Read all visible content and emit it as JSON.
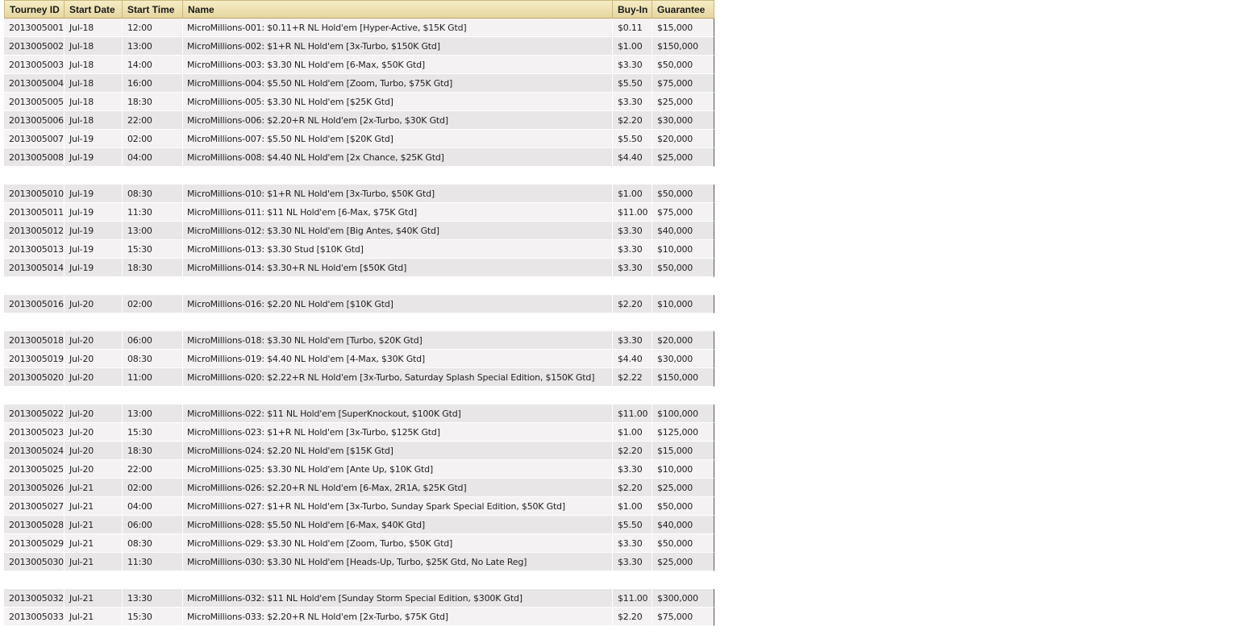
{
  "columns": [
    "Tourney ID",
    "Start Date",
    "Start Time",
    "Name",
    "Buy-In",
    "Guarantee"
  ],
  "rows": [
    {
      "id": "2013005001",
      "date": "Jul-18",
      "time": "12:00",
      "name": "MicroMillions-001: $0.11+R NL Hold'em [Hyper-Active, $15K Gtd]",
      "buyin": "$0.11",
      "guarantee": "$15,000"
    },
    {
      "id": "2013005002",
      "date": "Jul-18",
      "time": "13:00",
      "name": "MicroMillions-002: $1+R NL Hold'em [3x-Turbo, $150K Gtd]",
      "buyin": "$1.00",
      "guarantee": "$150,000"
    },
    {
      "id": "2013005003",
      "date": "Jul-18",
      "time": "14:00",
      "name": "MicroMillions-003: $3.30 NL Hold'em [6-Max, $50K Gtd]",
      "buyin": "$3.30",
      "guarantee": "$50,000"
    },
    {
      "id": "2013005004",
      "date": "Jul-18",
      "time": "16:00",
      "name": "MicroMillions-004: $5.50 NL Hold'em [Zoom, Turbo, $75K Gtd]",
      "buyin": "$5.50",
      "guarantee": "$75,000"
    },
    {
      "id": "2013005005",
      "date": "Jul-18",
      "time": "18:30",
      "name": "MicroMillions-005: $3.30 NL Hold'em [$25K Gtd]",
      "buyin": "$3.30",
      "guarantee": "$25,000"
    },
    {
      "id": "2013005006",
      "date": "Jul-18",
      "time": "22:00",
      "name": "MicroMillions-006: $2.20+R NL Hold'em [2x-Turbo, $30K Gtd]",
      "buyin": "$2.20",
      "guarantee": "$30,000"
    },
    {
      "id": "2013005007",
      "date": "Jul-19",
      "time": "02:00",
      "name": "MicroMillions-007: $5.50 NL Hold'em [$20K Gtd]",
      "buyin": "$5.50",
      "guarantee": "$20,000"
    },
    {
      "id": "2013005008",
      "date": "Jul-19",
      "time": "04:00",
      "name": "MicroMillions-008: $4.40 NL Hold'em [2x Chance, $25K Gtd]",
      "buyin": "$4.40",
      "guarantee": "$25,000"
    },
    null,
    {
      "id": "2013005010",
      "date": "Jul-19",
      "time": "08:30",
      "name": "MicroMillions-010: $1+R NL Hold'em [3x-Turbo, $50K Gtd]",
      "buyin": "$1.00",
      "guarantee": "$50,000"
    },
    {
      "id": "2013005011",
      "date": "Jul-19",
      "time": "11:30",
      "name": "MicroMillions-011: $11 NL Hold'em [6-Max, $75K Gtd]",
      "buyin": "$11.00",
      "guarantee": "$75,000"
    },
    {
      "id": "2013005012",
      "date": "Jul-19",
      "time": "13:00",
      "name": "MicroMillions-012: $3.30 NL Hold'em [Big Antes, $40K Gtd]",
      "buyin": "$3.30",
      "guarantee": "$40,000"
    },
    {
      "id": "2013005013",
      "date": "Jul-19",
      "time": "15:30",
      "name": "MicroMillions-013: $3.30 Stud [$10K Gtd]",
      "buyin": "$3.30",
      "guarantee": "$10,000"
    },
    {
      "id": "2013005014",
      "date": "Jul-19",
      "time": "18:30",
      "name": "MicroMillions-014: $3.30+R NL Hold'em [$50K Gtd]",
      "buyin": "$3.30",
      "guarantee": "$50,000"
    },
    null,
    {
      "id": "2013005016",
      "date": "Jul-20",
      "time": "02:00",
      "name": "MicroMillions-016: $2.20 NL Hold'em [$10K Gtd]",
      "buyin": "$2.20",
      "guarantee": "$10,000"
    },
    null,
    {
      "id": "2013005018",
      "date": "Jul-20",
      "time": "06:00",
      "name": "MicroMillions-018: $3.30 NL Hold'em [Turbo, $20K Gtd]",
      "buyin": "$3.30",
      "guarantee": "$20,000"
    },
    {
      "id": "2013005019",
      "date": "Jul-20",
      "time": "08:30",
      "name": "MicroMillions-019: $4.40 NL Hold'em [4-Max, $30K Gtd]",
      "buyin": "$4.40",
      "guarantee": "$30,000"
    },
    {
      "id": "2013005020",
      "date": "Jul-20",
      "time": "11:00",
      "name": "MicroMillions-020: $2.22+R NL Hold'em [3x-Turbo, Saturday Splash Special Edition, $150K Gtd]",
      "buyin": "$2.22",
      "guarantee": "$150,000"
    },
    null,
    {
      "id": "2013005022",
      "date": "Jul-20",
      "time": "13:00",
      "name": "MicroMillions-022: $11 NL Hold'em [SuperKnockout, $100K Gtd]",
      "buyin": "$11.00",
      "guarantee": "$100,000"
    },
    {
      "id": "2013005023",
      "date": "Jul-20",
      "time": "15:30",
      "name": "MicroMillions-023: $1+R NL Hold'em [3x-Turbo, $125K Gtd]",
      "buyin": "$1.00",
      "guarantee": "$125,000"
    },
    {
      "id": "2013005024",
      "date": "Jul-20",
      "time": "18:30",
      "name": "MicroMillions-024: $2.20 NL Hold'em [$15K Gtd]",
      "buyin": "$2.20",
      "guarantee": "$15,000"
    },
    {
      "id": "2013005025",
      "date": "Jul-20",
      "time": "22:00",
      "name": "MicroMillions-025: $3.30 NL Hold'em [Ante Up, $10K Gtd]",
      "buyin": "$3.30",
      "guarantee": "$10,000"
    },
    {
      "id": "2013005026",
      "date": "Jul-21",
      "time": "02:00",
      "name": "MicroMillions-026: $2.20+R NL Hold'em [6-Max, 2R1A, $25K Gtd]",
      "buyin": "$2.20",
      "guarantee": "$25,000"
    },
    {
      "id": "2013005027",
      "date": "Jul-21",
      "time": "04:00",
      "name": "MicroMillions-027: $1+R NL Hold'em [3x-Turbo, Sunday Spark Special Edition, $50K Gtd]",
      "buyin": "$1.00",
      "guarantee": "$50,000"
    },
    {
      "id": "2013005028",
      "date": "Jul-21",
      "time": "06:00",
      "name": "MicroMillions-028: $5.50 NL Hold'em [6-Max, $40K Gtd]",
      "buyin": "$5.50",
      "guarantee": "$40,000"
    },
    {
      "id": "2013005029",
      "date": "Jul-21",
      "time": "08:30",
      "name": "MicroMillions-029: $3.30 NL Hold'em [Zoom, Turbo, $50K Gtd]",
      "buyin": "$3.30",
      "guarantee": "$50,000"
    },
    {
      "id": "2013005030",
      "date": "Jul-21",
      "time": "11:30",
      "name": "MicroMillions-030: $3.30 NL Hold'em [Heads-Up, Turbo, $25K Gtd, No Late Reg]",
      "buyin": "$3.30",
      "guarantee": "$25,000"
    },
    null,
    {
      "id": "2013005032",
      "date": "Jul-21",
      "time": "13:30",
      "name": "MicroMillions-032: $11 NL Hold'em [Sunday Storm Special Edition, $300K Gtd]",
      "buyin": "$11.00",
      "guarantee": "$300,000"
    },
    {
      "id": "2013005033",
      "date": "Jul-21",
      "time": "15:30",
      "name": "MicroMillions-033: $2.20+R NL Hold'em [2x-Turbo, $75K Gtd]",
      "buyin": "$2.20",
      "guarantee": "$75,000"
    }
  ]
}
